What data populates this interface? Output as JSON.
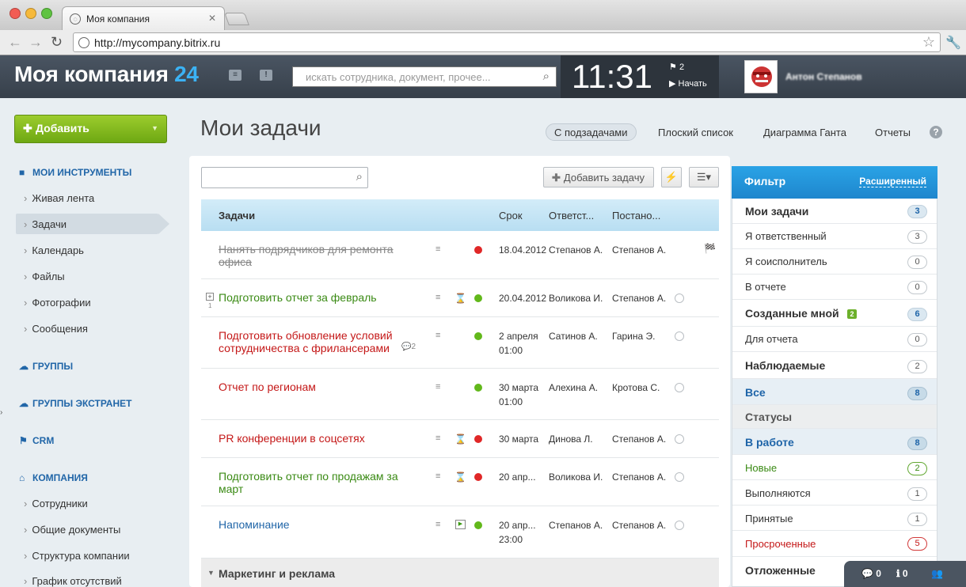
{
  "browser": {
    "tab_title": "Моя компания",
    "url": "http://mycompany.bitrix.ru"
  },
  "header": {
    "logo_text": "Моя компания",
    "logo_number": "24",
    "search_placeholder": "искать сотрудника, документ, прочее...",
    "clock": "11:31",
    "flag_count": "2",
    "start_label": "Начать",
    "user_name": "Антон Степанов"
  },
  "sidebar": {
    "add_button": "Добавить",
    "sections": [
      {
        "label": "МОИ ИНСТРУМЕНТЫ",
        "items": [
          "Живая лента",
          "Задачи",
          "Календарь",
          "Файлы",
          "Фотографии",
          "Сообщения"
        ]
      },
      {
        "label": "ГРУППЫ",
        "items": []
      },
      {
        "label": "ГРУППЫ ЭКСТРАНЕТ",
        "items": []
      },
      {
        "label": "CRM",
        "items": []
      },
      {
        "label": "КОМПАНИЯ",
        "items": [
          "Сотрудники",
          "Общие документы",
          "Структура компании",
          "График отсутствий"
        ]
      }
    ]
  },
  "main": {
    "title": "Мои задачи",
    "view_tabs": [
      "С подзадачами",
      "Плоский список",
      "Диаграмма Ганта",
      "Отчеты"
    ],
    "help": "?",
    "add_task": "Добавить задачу",
    "columns": [
      "Задачи",
      "Срок",
      "Ответст...",
      "Постано..."
    ],
    "tasks": [
      {
        "title_1": "Нанять подрядчиков для ремонта",
        "title_2": "офиса",
        "deadline_1": "18.04.2012",
        "deadline_2": "",
        "responsible": "Степанов А.",
        "creator": "Степанов А."
      },
      {
        "title_1": "Подготовить отчет за февраль",
        "title_2": "",
        "subtask_count": "1",
        "deadline_1": "20.04.2012",
        "deadline_2": "",
        "responsible": "Воликова И.",
        "creator": "Степанов А."
      },
      {
        "title_1": "Подготовить обновление условий",
        "title_2": "сотрудничества с фрилансерами",
        "comments": "2",
        "deadline_1": "2 апреля",
        "deadline_2": "01:00",
        "responsible": "Сатинов А.",
        "creator": "Гарина Э."
      },
      {
        "title_1": "Отчет по регионам",
        "title_2": "",
        "deadline_1": "30 марта",
        "deadline_2": "01:00",
        "responsible": "Алехина А.",
        "creator": "Кротова С."
      },
      {
        "title_1": "PR конференции в соцсетях",
        "title_2": "",
        "deadline_1": "30 марта",
        "deadline_2": "",
        "responsible": "Динова Л.",
        "creator": "Степанов А."
      },
      {
        "title_1": "Подготовить отчет по продажам за",
        "title_2": "март",
        "deadline_1": "20 апр...",
        "deadline_2": "",
        "responsible": "Воликова И.",
        "creator": "Степанов А."
      },
      {
        "title_1": "Напоминание",
        "title_2": "",
        "deadline_1": "20 апр...",
        "deadline_2": "23:00",
        "responsible": "Степанов А.",
        "creator": "Степанов А."
      }
    ],
    "group_label": "Маркетинг и реклама"
  },
  "filter": {
    "title": "Фильтр",
    "advanced": "Расширенный",
    "rows": [
      {
        "label": "Мои задачи",
        "count": "3"
      },
      {
        "label": "Я ответственный",
        "count": "3"
      },
      {
        "label": "Я соисполнитель",
        "count": "0"
      },
      {
        "label": "В отчете",
        "count": "0"
      },
      {
        "label": "Созданные мной",
        "count": "6",
        "badge": "2"
      },
      {
        "label": "Для отчета",
        "count": "0"
      },
      {
        "label": "Наблюдаемые",
        "count": "2"
      },
      {
        "label": "Все",
        "count": "8"
      },
      {
        "label": "Статусы",
        "count": ""
      },
      {
        "label": "В работе",
        "count": "8"
      },
      {
        "label": "Новые",
        "count": "2"
      },
      {
        "label": "Выполняются",
        "count": "1"
      },
      {
        "label": "Принятые",
        "count": "1"
      },
      {
        "label": "Просроченные",
        "count": "5"
      },
      {
        "label": "Отложенные",
        "count": ""
      }
    ]
  },
  "bottom_bar": {
    "messages": "0",
    "notifications": "0"
  },
  "colors": {
    "accent": "#3bb2f4",
    "header": "#37404b",
    "add_green": "#7ab51d",
    "link_blue": "#2166a8"
  }
}
